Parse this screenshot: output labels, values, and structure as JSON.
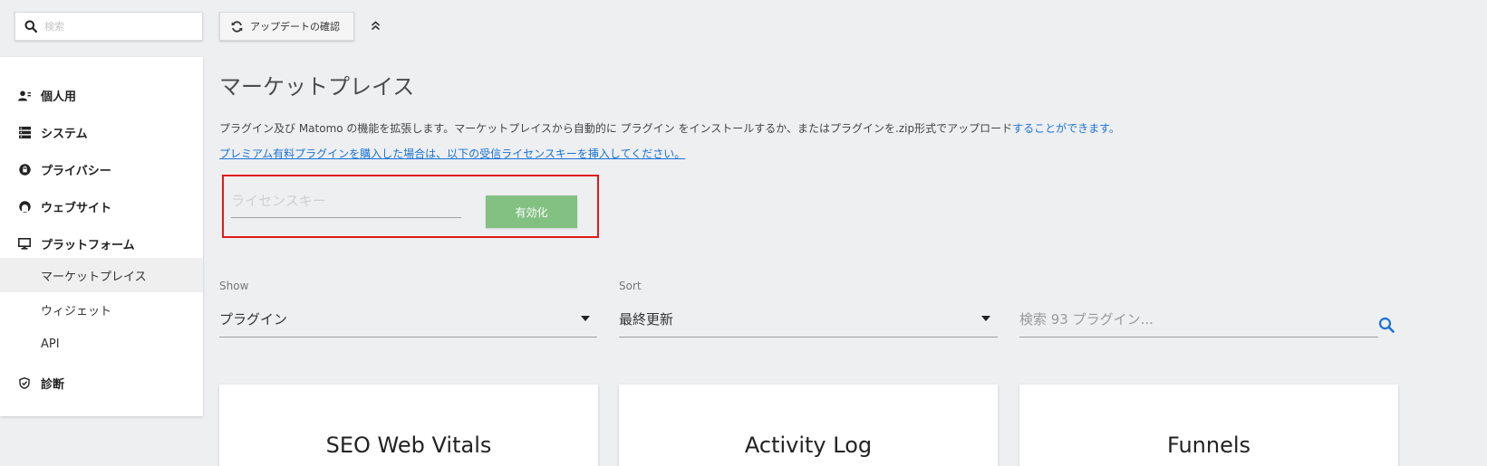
{
  "top_search": {
    "placeholder": "検索"
  },
  "toolbar": {
    "update_label": "アップデートの確認"
  },
  "sidebar": {
    "categories": [
      {
        "label": "個人用",
        "icon": "user-icon"
      },
      {
        "label": "システム",
        "icon": "server-icon"
      },
      {
        "label": "プライバシー",
        "icon": "lock-icon"
      },
      {
        "label": "ウェブサイト",
        "icon": "website-icon"
      },
      {
        "label": "プラットフォーム",
        "icon": "monitor-icon"
      },
      {
        "label": "診断",
        "icon": "shield-check-icon"
      }
    ],
    "platform_items": [
      {
        "label": "マーケットプレイス",
        "active": true
      },
      {
        "label": "ウィジェット",
        "active": false
      },
      {
        "label": "API",
        "active": false
      }
    ]
  },
  "main": {
    "title": "マーケットプレイス",
    "description": "プラグイン及び Matomo の機能を拡張します。マーケットプレイスから自動的に プラグイン をインストールするか、またはプラグインを.zip形式でアップロード",
    "description_link": "することができます。",
    "premium_link": "プレミアム有料プラグインを購入した場合は、以下の受信ライセンスキーを挿入してください。"
  },
  "license": {
    "placeholder": "ライセンスキー",
    "activate_label": "有効化"
  },
  "filters": {
    "show_label": "Show",
    "show_value": "プラグイン",
    "sort_label": "Sort",
    "sort_value": "最終更新",
    "search_placeholder": "検索 93 プラグイン..."
  },
  "plugins": [
    {
      "title": "SEO Web Vitals"
    },
    {
      "title": "Activity Log"
    },
    {
      "title": "Funnels"
    }
  ],
  "colors": {
    "accent_link": "#1a73d6",
    "activate_button": "#83c183",
    "highlight_border": "#e01b1b",
    "background": "#eeeff1"
  }
}
